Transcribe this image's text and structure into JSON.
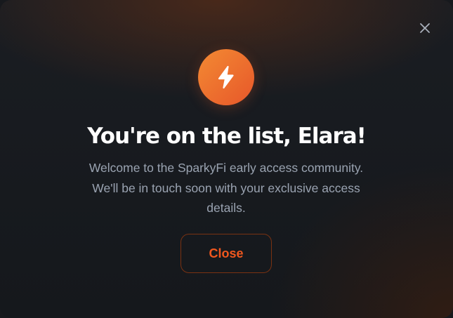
{
  "dialog": {
    "title": "You're on the list, Elara!",
    "message": "Welcome to the SparkyFi early access community. We'll be in touch soon with your exclusive access details.",
    "close_button_label": "Close",
    "dismiss_icon": "close-icon",
    "badge_icon": "lightning-bolt-icon"
  },
  "colors": {
    "accent": "#f0571e",
    "badge_gradient_start": "#f38a33",
    "badge_gradient_end": "#e7572a",
    "title": "#ffffff",
    "body_text": "#9aa3b1",
    "background": "#17191d"
  }
}
